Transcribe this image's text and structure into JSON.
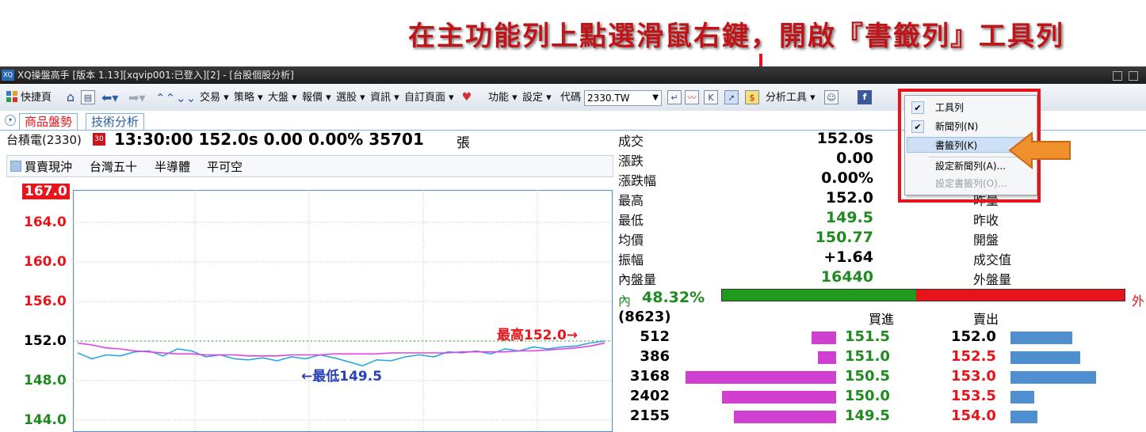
{
  "caption": "在主功能列上點選滑鼠右鍵，開啟『書籤列』工具列",
  "window": {
    "title": "XQ操盤高手 [版本 1.13][xqvip001:已登入][2] - [台股個股分析]",
    "logo": "XQ"
  },
  "toolbar": {
    "quick_page": "快捷頁",
    "menus": [
      "交易",
      "策略",
      "大盤",
      "報價",
      "選股",
      "資訊",
      "自訂頁面",
      "功能",
      "設定"
    ],
    "code_label": "代碼",
    "code_value": "2330.TW",
    "analysis_tools": "分析工具"
  },
  "tabs": [
    "商品盤勢",
    "技術分析"
  ],
  "stock": {
    "name": "台積電(2330)",
    "badge": "30",
    "time": "13:30:00",
    "price": "152.0s",
    "change": "0.00",
    "change_pct": "0.00%",
    "volume": "35701",
    "volume_unit": "張"
  },
  "subbar": {
    "items": [
      "買賣現沖",
      "台灣五十",
      "半導體",
      "平可空"
    ]
  },
  "chart_data": {
    "type": "line",
    "y_ticks": [
      "167.0",
      "164.0",
      "160.0",
      "156.0",
      "152.0",
      "148.0",
      "144.0"
    ],
    "ylim": [
      144,
      167
    ],
    "high_label": "最高152.0→",
    "low_label": "←最低149.5",
    "series": [
      {
        "color": "#29a8e0",
        "values": [
          150.8,
          150.2,
          150.6,
          150.5,
          150.9,
          151.0,
          150.5,
          151.2,
          151.0,
          150.4,
          150.6,
          150.2,
          150.1,
          150.3,
          150.0,
          150.4,
          150.2,
          150.6,
          150.3,
          149.9,
          149.5,
          150.1,
          150.0,
          150.4,
          150.6,
          150.4,
          150.9,
          150.8,
          151.0,
          150.7,
          151.2,
          151.0,
          151.4,
          151.2,
          151.4,
          151.5,
          151.8,
          152.0
        ]
      },
      {
        "color": "#e040e8",
        "values": [
          151.8,
          151.6,
          151.3,
          151.2,
          151.0,
          150.9,
          150.8,
          150.7,
          150.7,
          150.6,
          150.6,
          150.6,
          150.5,
          150.5,
          150.5,
          150.6,
          150.6,
          150.6,
          150.7,
          150.7,
          150.7,
          150.7,
          150.8,
          150.8,
          150.8,
          150.8,
          150.8,
          150.9,
          150.9,
          150.9,
          150.9,
          151.0,
          151.0,
          151.1,
          151.2,
          151.3,
          151.5,
          151.8
        ]
      }
    ]
  },
  "quote": {
    "rows": [
      {
        "label": "成交",
        "value": "152.0s",
        "color": "blk"
      },
      {
        "label": "漲跌",
        "value": "0.00",
        "color": "blk"
      },
      {
        "label": "漲跌幅",
        "value": "0.00%",
        "color": "blk"
      },
      {
        "label": "最高",
        "value": "152.0",
        "color": "blk"
      },
      {
        "label": "最低",
        "value": "149.5",
        "color": "green"
      },
      {
        "label": "均價",
        "value": "150.77",
        "color": "green"
      },
      {
        "label": "振幅",
        "value": "+1.64",
        "color": "blk"
      },
      {
        "label": "內盤量",
        "value": "16440",
        "color": "green"
      }
    ],
    "right_labels": [
      "昨量",
      "昨收",
      "開盤",
      "成交值",
      "外盤量"
    ],
    "inner_label": "內",
    "inner_pct": "48.32%",
    "inner_ratio": 0.4832,
    "outer_label": "外"
  },
  "orderbook": {
    "count": "(8623)",
    "bid_header": "買進",
    "ask_header": "賣出",
    "rows": [
      {
        "bid_vol": "512",
        "bid": "151.5",
        "ask": "152.0",
        "bid_size": 512,
        "ask_size": 1220
      },
      {
        "bid_vol": "386",
        "bid": "151.0",
        "ask": "152.5",
        "bid_size": 386,
        "ask_size": 1380
      },
      {
        "bid_vol": "3168",
        "bid": "150.5",
        "ask": "153.0",
        "bid_size": 3168,
        "ask_size": 1700
      },
      {
        "bid_vol": "2402",
        "bid": "150.0",
        "ask": "153.5",
        "bid_size": 2402,
        "ask_size": 470
      },
      {
        "bid_vol": "2155",
        "bid": "149.5",
        "ask": "154.0",
        "bid_size": 2155,
        "ask_size": 540
      }
    ]
  },
  "context_menu": {
    "items": [
      {
        "label": "工具列",
        "checked": true
      },
      {
        "label": "新聞列(N)",
        "checked": true
      },
      {
        "label": "書籤列(K)",
        "checked": false,
        "highlighted": true
      },
      {
        "label": "設定新聞列(A)...",
        "checked": false
      },
      {
        "label": "設定書籤列(O)...",
        "checked": false,
        "disabled": true
      }
    ]
  }
}
